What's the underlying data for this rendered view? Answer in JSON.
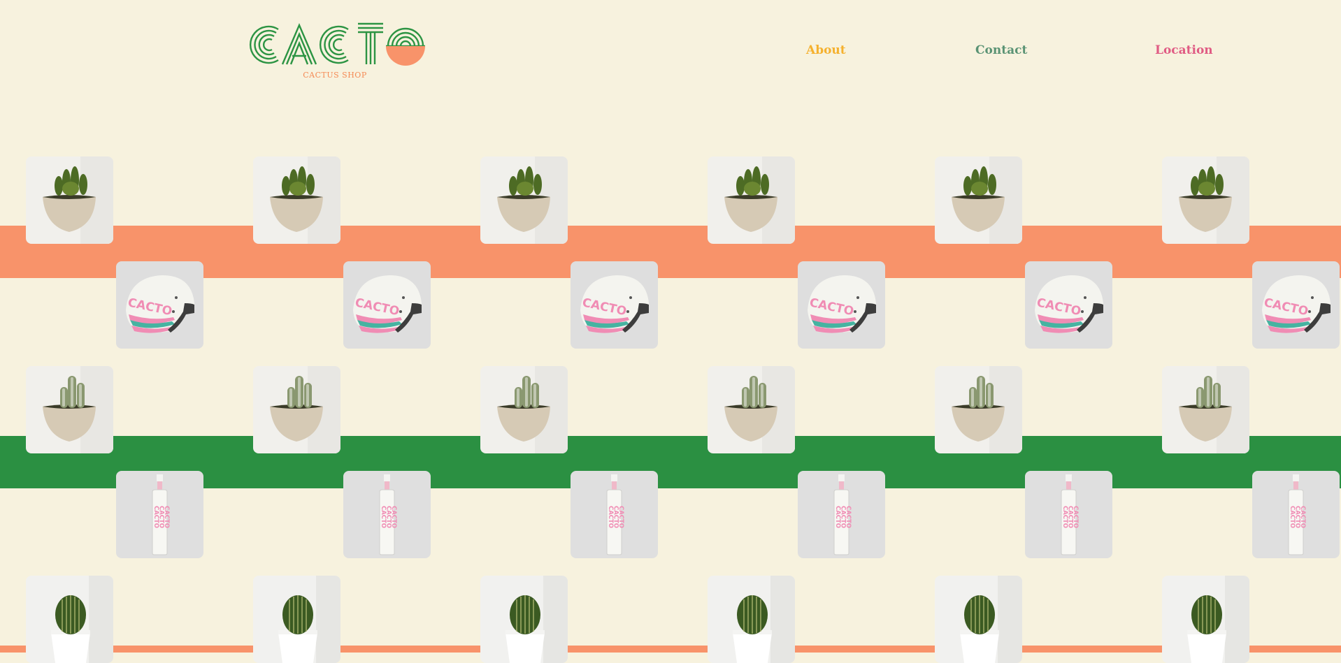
{
  "brand": {
    "logo_text": "CACTO",
    "tagline": "CACTUS SHOP",
    "logo_icon": "cacto-logo"
  },
  "nav": [
    {
      "label": "About",
      "color": "#f5b12e"
    },
    {
      "label": "Contact",
      "color": "#5a9374"
    },
    {
      "label": "Location",
      "color": "#e05c84"
    }
  ],
  "colors": {
    "background": "#f7f2de",
    "orange": "#f8936a",
    "green": "#2b9042",
    "logo_green": "#2c9443",
    "pink": "#f08cb4"
  },
  "products": [
    {
      "name": "bushy-cactus-in-beige-pot",
      "icon": "bushy-cactus-pot-image"
    },
    {
      "name": "cacto-motorcycle-helmet",
      "icon": "cacto-helmet-image"
    },
    {
      "name": "tall-cactus-in-beige-pot",
      "icon": "tall-cactus-pot-image"
    },
    {
      "name": "cacto-spray-bottle",
      "icon": "cacto-bottle-image"
    },
    {
      "name": "round-cactus-in-white-pot",
      "icon": "round-cactus-pot-image"
    }
  ],
  "helmet_print": "CACTO",
  "bottle_print": "CACTO"
}
